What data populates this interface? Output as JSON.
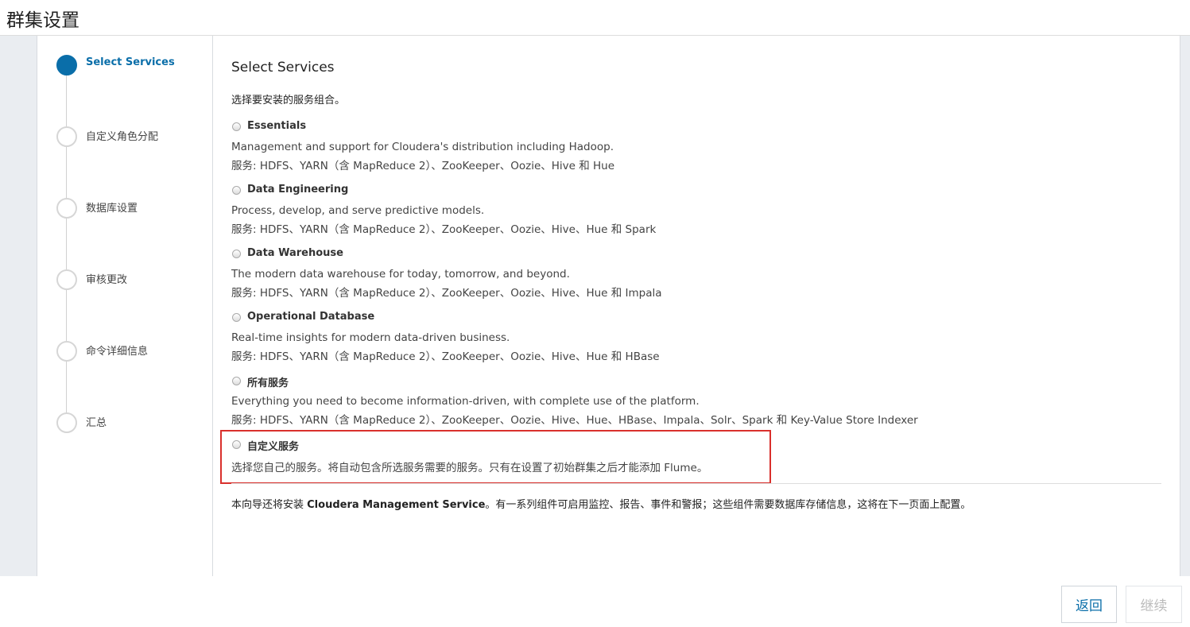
{
  "page": {
    "title": "群集设置"
  },
  "steps": [
    {
      "label": "Select Services",
      "active": true
    },
    {
      "label": "自定义角色分配",
      "active": false
    },
    {
      "label": "数据库设置",
      "active": false
    },
    {
      "label": "审核更改",
      "active": false
    },
    {
      "label": "命令详细信息",
      "active": false
    },
    {
      "label": "汇总",
      "active": false
    }
  ],
  "main": {
    "heading": "Select Services",
    "intro": "选择要安装的服务组合。",
    "options": [
      {
        "name": "Essentials",
        "description": "Management and support for Cloudera's distribution including Hadoop.",
        "services": "服务: HDFS、YARN（含 MapReduce 2）、ZooKeeper、Oozie、Hive 和 Hue"
      },
      {
        "name": "Data Engineering",
        "description": "Process, develop, and serve predictive models.",
        "services": "服务: HDFS、YARN（含 MapReduce 2）、ZooKeeper、Oozie、Hive、Hue 和 Spark"
      },
      {
        "name": "Data Warehouse",
        "description": "The modern data warehouse for today, tomorrow, and beyond.",
        "services": "服务: HDFS、YARN（含 MapReduce 2）、ZooKeeper、Oozie、Hive、Hue 和 Impala"
      },
      {
        "name": "Operational Database",
        "description": "Real-time insights for modern data-driven business.",
        "services": "服务: HDFS、YARN（含 MapReduce 2）、ZooKeeper、Oozie、Hive、Hue 和 HBase"
      },
      {
        "name": "所有服务",
        "description": "Everything you need to become information-driven, with complete use of the platform.",
        "services": "服务: HDFS、YARN（含 MapReduce 2）、ZooKeeper、Oozie、Hive、Hue、HBase、Impala、Solr、Spark 和 Key-Value Store Indexer"
      },
      {
        "name": "自定义服务",
        "description": "选择您自己的服务。将自动包含所选服务需要的服务。只有在设置了初始群集之后才能添加 Flume。"
      }
    ],
    "note_prefix": "本向导还将安装 ",
    "note_bold": "Cloudera Management Service",
    "note_suffix": "。有一系列组件可启用监控、报告、事件和警报；这些组件需要数据库存储信息，这将在下一页面上配置。"
  },
  "footer": {
    "back_label": "返回",
    "continue_label": "继续"
  },
  "colors": {
    "accent": "#0a6ea9",
    "highlight": "#d9302c"
  }
}
